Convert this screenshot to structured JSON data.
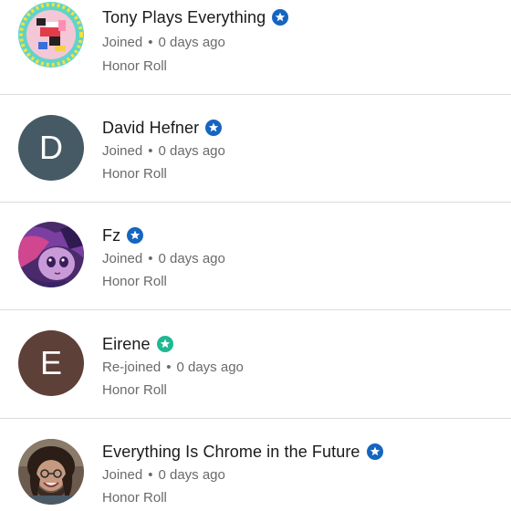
{
  "members": [
    {
      "name": "Tony Plays Everything",
      "status": "Joined",
      "separator": "•",
      "time": "0 days ago",
      "tier": "Honor Roll",
      "avatar_type": "image",
      "badge_color": "#1565c0"
    },
    {
      "name": "David Hefner",
      "status": "Joined",
      "separator": "•",
      "time": "0 days ago",
      "tier": "Honor Roll",
      "avatar_type": "letter",
      "avatar_letter": "D",
      "avatar_color": "#455a64",
      "badge_color": "#1565c0"
    },
    {
      "name": "Fz",
      "status": "Joined",
      "separator": "•",
      "time": "0 days ago",
      "tier": "Honor Roll",
      "avatar_type": "image",
      "badge_color": "#1565c0"
    },
    {
      "name": "Eirene",
      "status": "Re-joined",
      "separator": "•",
      "time": "0 days ago",
      "tier": "Honor Roll",
      "avatar_type": "letter",
      "avatar_letter": "E",
      "avatar_color": "#5d4037",
      "badge_color": "#1fb892"
    },
    {
      "name": "Everything Is Chrome in the Future",
      "status": "Joined",
      "separator": "•",
      "time": "0 days ago",
      "tier": "Honor Roll",
      "avatar_type": "image",
      "badge_color": "#1565c0"
    }
  ]
}
